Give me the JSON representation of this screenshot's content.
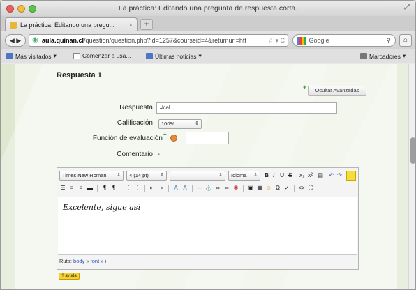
{
  "window": {
    "title": "La práctica: Editando una pregunta de respuesta corta."
  },
  "tabs": [
    {
      "label": "La práctica: Editando una pregu..."
    }
  ],
  "nav": {
    "url_domain": "aula.quinan.cl",
    "url_path": "/question/question.php?id=1257&courseid=4&returnurl=htt",
    "search_placeholder": "Google"
  },
  "bookmarks": [
    {
      "label": "Más visitados",
      "icon": "most-visited-icon"
    },
    {
      "label": "Comenzar a usa...",
      "icon": "page-icon"
    },
    {
      "label": "Últimas noticias",
      "icon": "rss-icon"
    },
    {
      "label": "Marcadores",
      "icon": "bookmarks-icon"
    }
  ],
  "form": {
    "section_heading": "Respuesta 1",
    "advanced_button": "Ocultar Avanzadas",
    "answer_label": "Respuesta",
    "answer_value": "#cal",
    "grade_label": "Calificación",
    "grade_value": "100%",
    "graded_label": "Función de evaluación",
    "comment_label": "Comentario"
  },
  "editor": {
    "font_family": "Times New Roman",
    "font_size": "4 (14 pt)",
    "style_select": "",
    "language_select": "Idioma",
    "content_text": "Excelente, sigue así",
    "path_label": "Ruta:",
    "path_items": [
      "body",
      "font",
      "i"
    ],
    "badge_label": "? ayuda"
  },
  "colors": {
    "page_background": "#e9efdf",
    "highlight_yellow": "#f7dd3a",
    "link_blue": "#2f56b0"
  }
}
